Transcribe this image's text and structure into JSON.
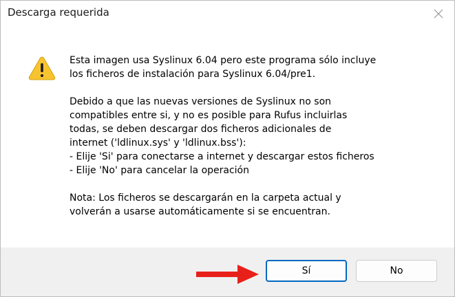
{
  "window": {
    "title": "Descarga requerida"
  },
  "icons": {
    "close": "close-icon",
    "warning": "warning-icon",
    "arrow": "red-arrow-icon"
  },
  "message": {
    "paragraphs": [
      [
        "Esta imagen usa Syslinux 6.04 pero este programa sólo incluye",
        "los ficheros de instalación para Syslinux 6.04/pre1."
      ],
      [
        "Debido a que las nuevas versiones de Syslinux no son",
        "compatibles entre si, y no es posible para Rufus incluirlas",
        "todas, se deben descargar dos ficheros adicionales de",
        "internet ('ldlinux.sys' y 'ldlinux.bss'):",
        "- Elije 'Si' para conectarse a internet y descargar estos ficheros",
        "- Elije 'No' para cancelar la operación"
      ],
      [
        "Nota: Los ficheros se descargarán en la carpeta actual y",
        "volverán a usarse automáticamente si se encuentran."
      ]
    ]
  },
  "buttons": {
    "yes_label": "Sí",
    "no_label": "No"
  },
  "colors": {
    "warning_fill": "#f7c32e",
    "focus_border": "#0067c0",
    "arrow": "#e8201a",
    "footer_bg": "#f0f0f0"
  }
}
